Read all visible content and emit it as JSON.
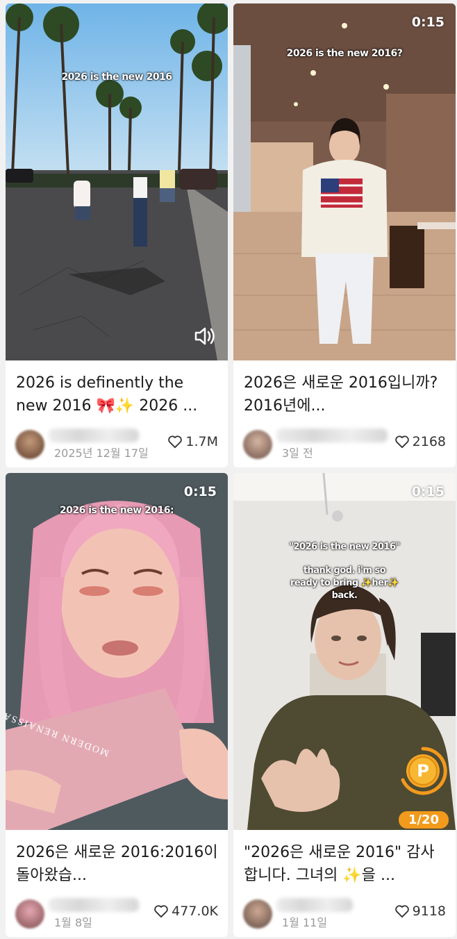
{
  "cards": [
    {
      "overlay": "2026 is the new 2016",
      "duration": "",
      "title": "2026 is definently the new 2016 🎀✨ 2026 ...",
      "date": "2025년 12월 17일",
      "likes": "1.7M",
      "icon": "speaker-icon"
    },
    {
      "overlay": "2026 is the new 2016?",
      "duration": "0:15",
      "title": "2026은 새로운 2016입니까? 2016년에...",
      "date": "3일 전",
      "likes": "2168"
    },
    {
      "overlay": "2026 is the new 2016:",
      "duration": "0:15",
      "title": "2026은 새로운 2016:2016이 돌아왔습...",
      "date": "1월 8일",
      "likes": "477.0K"
    },
    {
      "overlay": "\"2026 is the new 2016\"",
      "overlay2": "thank god. i'm so ready to bring ✨her✨ back.",
      "duration": "0:15",
      "title": "\"2026은 새로운 2016\" 감사합니다. 그녀의 ✨을 ...",
      "date": "1월 11일",
      "likes": "9118",
      "coin_label": "P",
      "pager": "1/20"
    }
  ],
  "colors": {
    "accent_orange": "#f29a1c",
    "background": "#f1f1f2"
  }
}
